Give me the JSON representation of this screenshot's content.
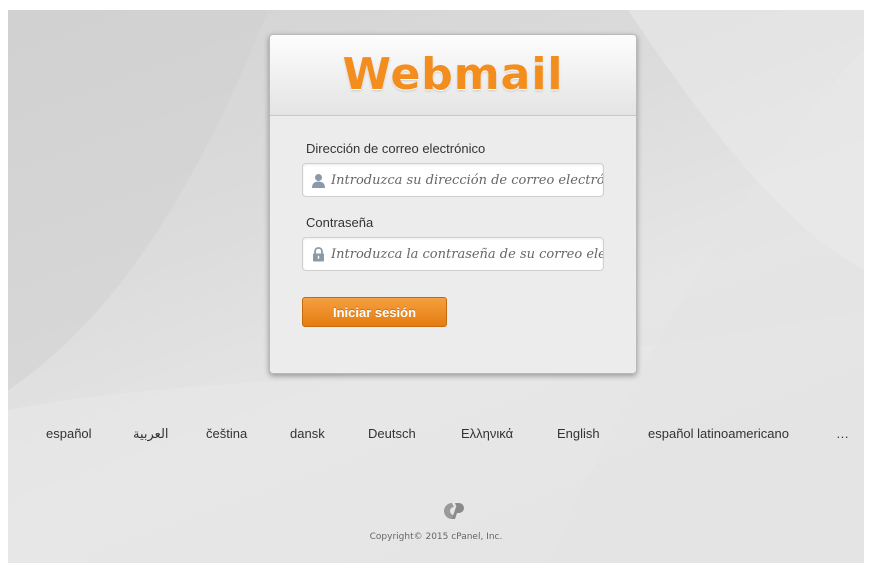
{
  "logo": {
    "text": "Webmail"
  },
  "form": {
    "email_label": "Dirección de correo electrónico",
    "email_placeholder": "Introduzca su dirección de correo electrónico",
    "password_label": "Contraseña",
    "password_placeholder": "Introduzca la contraseña de su correo electrónico",
    "login_button": "Iniciar sesión"
  },
  "languages": [
    "español",
    "العربية",
    "čeština",
    "dansk",
    "Deutsch",
    "Ελληνικά",
    "English",
    "español latinoamericano",
    "…"
  ],
  "footer": {
    "copyright": "Copyright© 2015 cPanel, Inc."
  },
  "icons": {
    "email_field": "user-icon",
    "password_field": "lock-icon",
    "footer": "cpanel-logo-icon"
  },
  "colors": {
    "brand_orange": "#f38d1e",
    "button_orange": "#e98316"
  }
}
